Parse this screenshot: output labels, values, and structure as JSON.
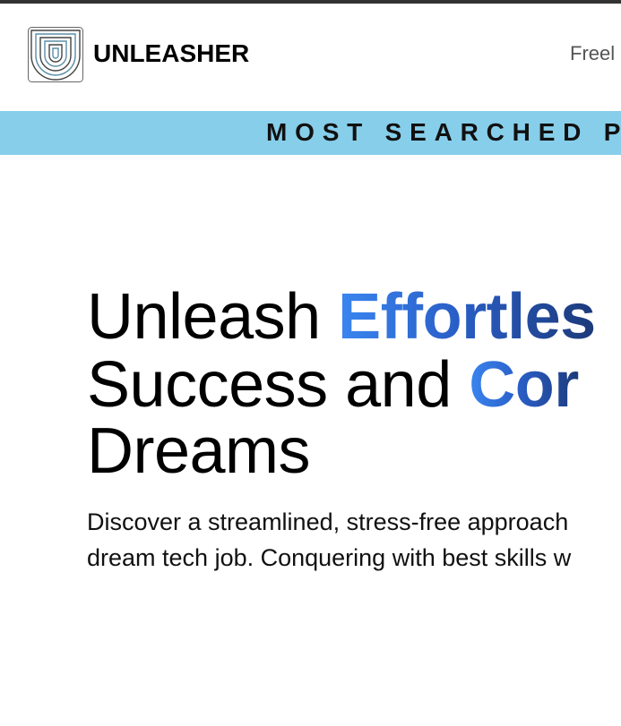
{
  "header": {
    "brand": "UNLEASHER",
    "nav_link": "Freel"
  },
  "banner": {
    "text": "MOST SEARCHED P"
  },
  "hero": {
    "line1_plain": "Unleash ",
    "line1_accent": "Effortles",
    "line2_plain": "Success and ",
    "line2_accent": "Cor",
    "line3_plain": "Dreams",
    "accent_colors": [
      "#3a86f0",
      "#2a5fc8",
      "#1c3a7a"
    ]
  },
  "subtitle": {
    "line1": "Discover a streamlined, stress-free approach",
    "line2": "dream tech job. Conquering with best skills w"
  },
  "colors": {
    "banner_bg": "#87ceea",
    "top_border": "#333333"
  }
}
